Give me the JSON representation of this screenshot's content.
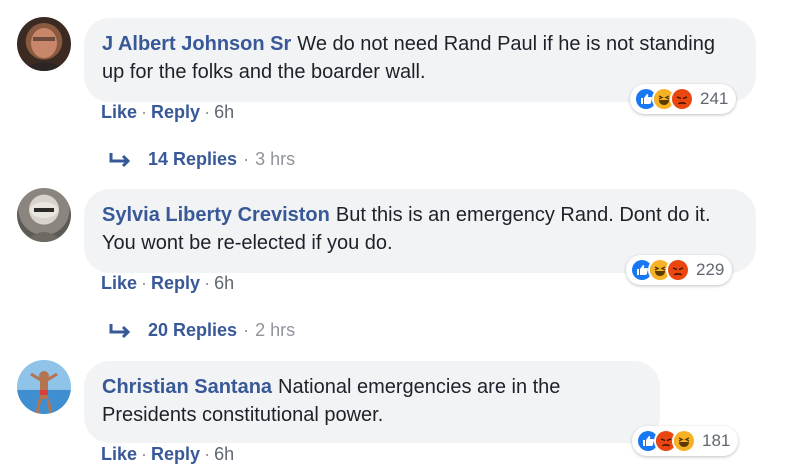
{
  "comments": [
    {
      "author": "J Albert Johnson Sr",
      "text": "We do not need Rand Paul if he is not standing up for the folks and the boarder wall.",
      "reactions": [
        "like",
        "haha",
        "angry"
      ],
      "reaction_count": "241",
      "actions": {
        "like": "Like",
        "reply": "Reply",
        "time": "6h"
      },
      "replies": {
        "count": "14 Replies",
        "time": "3 hrs"
      }
    },
    {
      "author": "Sylvia Liberty Creviston",
      "text": "But this is an emergency Rand. Dont do it. You wont be re-elected if you do.",
      "reactions": [
        "like",
        "haha",
        "angry"
      ],
      "reaction_count": "229",
      "actions": {
        "like": "Like",
        "reply": "Reply",
        "time": "6h"
      },
      "replies": {
        "count": "20 Replies",
        "time": "2 hrs"
      }
    },
    {
      "author": "Christian Santana",
      "text": "National emergencies are in the Presidents constitutional power.",
      "reactions": [
        "like",
        "angry",
        "haha"
      ],
      "reaction_count": "181",
      "actions": {
        "like": "Like",
        "reply": "Reply",
        "time": "6h"
      }
    }
  ],
  "colors": {
    "link": "#385898",
    "bubble": "#f2f3f5",
    "like": "#1877f2",
    "haha": "#f7b125",
    "angry": "#e9710f"
  },
  "separator": "·"
}
